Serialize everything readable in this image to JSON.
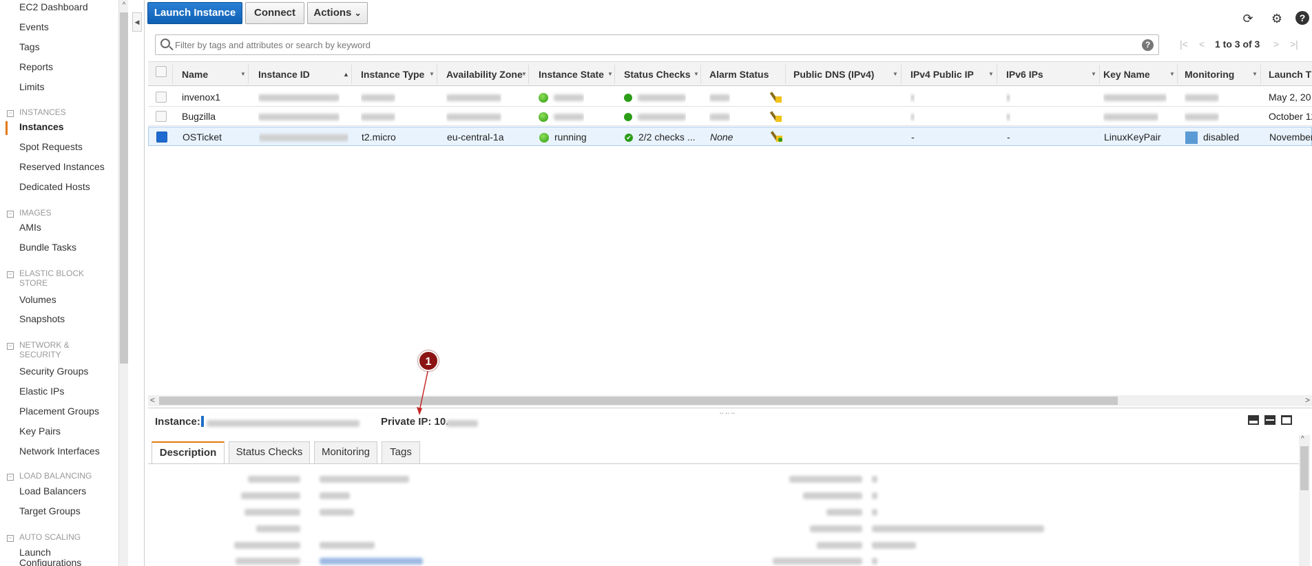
{
  "sidebar": {
    "items": [
      {
        "label": "EC2 Dashboard"
      },
      {
        "label": "Events"
      },
      {
        "label": "Tags"
      },
      {
        "label": "Reports"
      },
      {
        "label": "Limits"
      },
      {
        "label": "Instances"
      },
      {
        "label": "Spot Requests"
      },
      {
        "label": "Reserved Instances"
      },
      {
        "label": "Dedicated Hosts"
      },
      {
        "label": "AMIs"
      },
      {
        "label": "Bundle Tasks"
      },
      {
        "label": "Volumes"
      },
      {
        "label": "Snapshots"
      },
      {
        "label": "Security Groups"
      },
      {
        "label": "Elastic IPs"
      },
      {
        "label": "Placement Groups"
      },
      {
        "label": "Key Pairs"
      },
      {
        "label": "Network Interfaces"
      },
      {
        "label": "Load Balancers"
      },
      {
        "label": "Target Groups"
      },
      {
        "label": "Launch"
      },
      {
        "label": "Configurations"
      }
    ],
    "sections": [
      {
        "l1": "INSTANCES",
        "l2": ""
      },
      {
        "l1": "IMAGES",
        "l2": ""
      },
      {
        "l1": "ELASTIC BLOCK",
        "l2": "STORE"
      },
      {
        "l1": "NETWORK &",
        "l2": "SECURITY"
      },
      {
        "l1": "LOAD BALANCING",
        "l2": ""
      },
      {
        "l1": "AUTO SCALING",
        "l2": ""
      }
    ],
    "section_toggle": "−"
  },
  "toolbar": {
    "launch_label": "Launch Instance",
    "connect_label": "Connect",
    "actions_label": "Actions",
    "actions_caret": "⌄",
    "refresh_icon": "⟳",
    "settings_icon": "⚙",
    "help_icon": "?"
  },
  "filter": {
    "placeholder": "Filter by tags and attributes or search by keyword",
    "help": "?"
  },
  "pager": {
    "text": "1 to 3 of 3",
    "first": "|<",
    "prev": "<",
    "next": ">",
    "last": ">|"
  },
  "table": {
    "columns": [
      "Name",
      "Instance ID",
      "Instance Type",
      "Availability Zone",
      "Instance State",
      "Status Checks",
      "Alarm Status",
      "Public DNS (IPv4)",
      "IPv4 Public IP",
      "IPv6 IPs",
      "Key Name",
      "Monitoring",
      "Launch T"
    ],
    "sort_asc": "▲",
    "col_caret": "▼",
    "rows": [
      {
        "name": "invenox1",
        "launch": "May 2, 20",
        "selected": false
      },
      {
        "name": "Bugzilla",
        "launch": "October 12",
        "selected": false
      },
      {
        "name": "OSTicket",
        "type": "t2.micro",
        "zone": "eu-central-1a",
        "state": "running",
        "checks": "2/2 checks ...",
        "alarm": "None",
        "dns": "",
        "ipv4": "-",
        "ipv6": "-",
        "key": "LinuxKeyPair",
        "monitoring": "disabled",
        "launch": "November",
        "check_mark": "✔",
        "selected": true
      }
    ]
  },
  "scrollbars": {
    "left": "<",
    "right": ">",
    "up": "^"
  },
  "sidebar_collapse_icon": "◀",
  "details": {
    "instance_label": "Instance:",
    "private_ip_label": "Private IP: 10.",
    "grip": "⠤⠤⠤",
    "tabs": [
      "Description",
      "Status Checks",
      "Monitoring",
      "Tags"
    ]
  },
  "annotation": {
    "number": "1"
  },
  "colors": {
    "primary": "#1565c0",
    "accent": "#e47911",
    "running": "#2d9a10"
  }
}
